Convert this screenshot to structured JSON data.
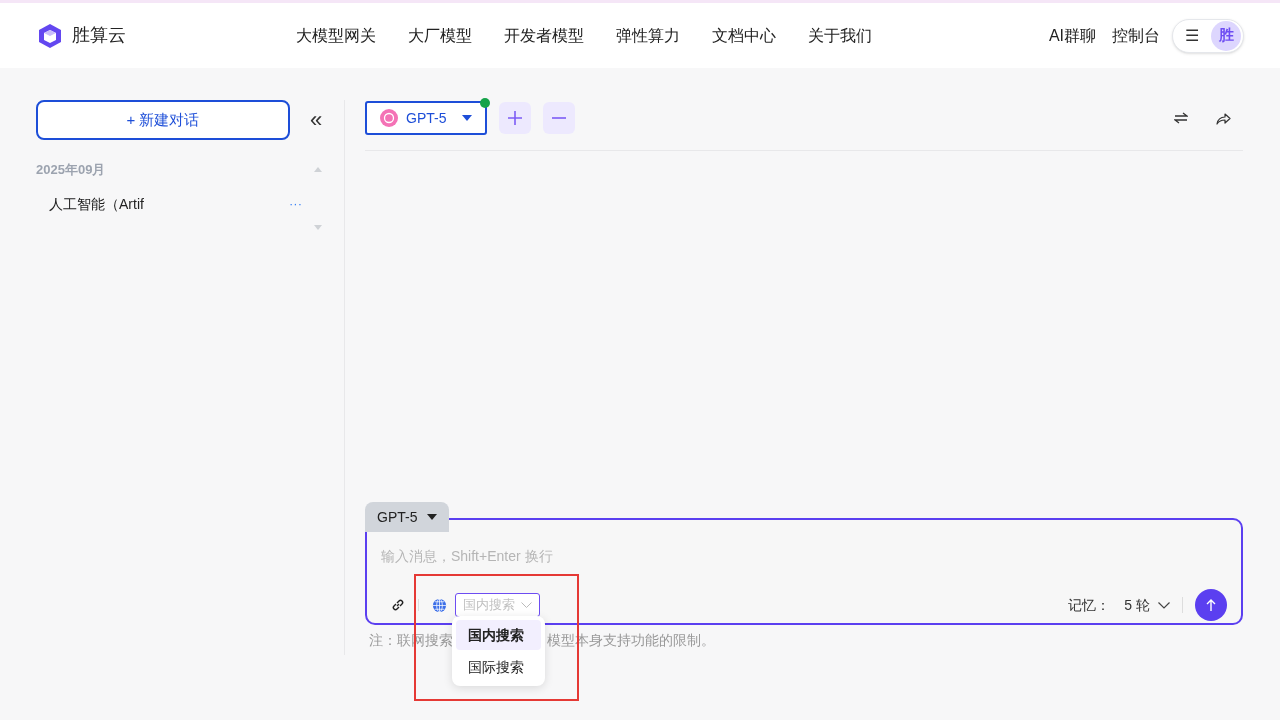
{
  "header": {
    "brand": "胜算云",
    "nav": [
      {
        "label": "大模型网关"
      },
      {
        "label": "大厂模型"
      },
      {
        "label": "开发者模型"
      },
      {
        "label": "弹性算力"
      },
      {
        "label": "文档中心"
      },
      {
        "label": "关于我们"
      }
    ],
    "links": [
      {
        "label": "AI群聊"
      },
      {
        "label": "控制台"
      }
    ],
    "menu_glyph": "☰",
    "avatar": "胜"
  },
  "sidebar": {
    "new_chat": "+ 新建对话",
    "collapse_glyph": "«",
    "groups": [
      {
        "date": "2025年09月",
        "items": [
          {
            "title": "人工智能（Artif",
            "more": "···"
          }
        ]
      }
    ]
  },
  "toolbar": {
    "model": "GPT-5",
    "online": true
  },
  "composer": {
    "model_tab": "GPT-5",
    "placeholder": "输入消息，Shift+Enter 换行",
    "search_select": {
      "placeholder": "国内搜索",
      "options": [
        {
          "label": "国内搜索",
          "selected": true
        },
        {
          "label": "国际搜索",
          "selected": false
        }
      ]
    },
    "memory_label": "记忆：",
    "memory_value": "5 轮"
  },
  "note": {
    "start": "注：联网搜索",
    "end": "模型本身支持功能的限制。"
  },
  "highlight": {
    "kind": "rectangle"
  }
}
